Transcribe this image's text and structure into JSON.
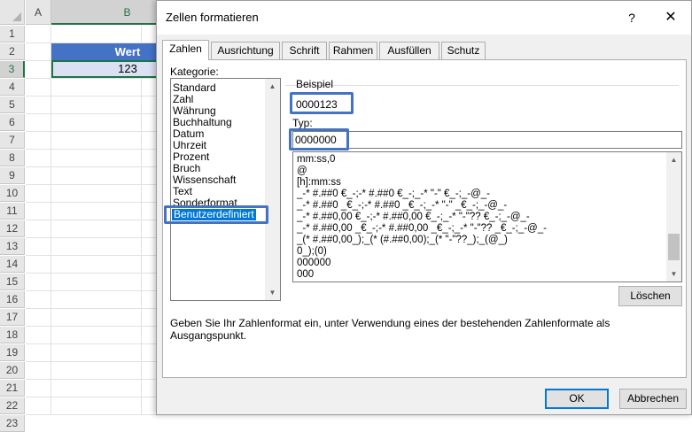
{
  "sheet": {
    "columns": [
      "A",
      "B"
    ],
    "rows": [
      "1",
      "2",
      "3",
      "4",
      "5",
      "6",
      "7",
      "8",
      "9",
      "10",
      "11",
      "12",
      "13",
      "14",
      "15",
      "16",
      "17",
      "18",
      "19",
      "20",
      "21",
      "22",
      "23"
    ],
    "header_cell": "Wert",
    "value_cell": "123"
  },
  "dialog": {
    "title": "Zellen formatieren",
    "help_glyph": "?",
    "close_glyph": "✕",
    "tabs": [
      "Zahlen",
      "Ausrichtung",
      "Schrift",
      "Rahmen",
      "Ausfüllen",
      "Schutz"
    ],
    "active_tab": "Zahlen",
    "kategorie_label": "Kategorie:",
    "categories": [
      "Standard",
      "Zahl",
      "Währung",
      "Buchhaltung",
      "Datum",
      "Uhrzeit",
      "Prozent",
      "Bruch",
      "Wissenschaft",
      "Text",
      "Sonderformat",
      "Benutzerdefiniert"
    ],
    "selected_category": "Benutzerdefiniert",
    "beispiel_label": "Beispiel",
    "beispiel_value": "0000123",
    "typ_label": "Typ:",
    "typ_value": "0000000",
    "formats": [
      "mm:ss,0",
      "@",
      "[h]:mm:ss",
      "_-* #.##0 €_-;-* #.##0 €_-;_-* \"-\" €_-;_-@_-",
      "_-* #.##0 _€_-;-* #.##0 _€_-;_-* \"-\" _€_-;_-@_-",
      "_-* #.##0,00 €_-;-* #.##0,00 €_-;_-* \"-\"?? €_-;_-@_-",
      "_-* #.##0,00 _€_-;-* #.##0,00 _€_-;_-* \"-\"?? _€_-;_-@_-",
      "_(* #.##0,00_);_(* (#.##0,00);_(* \"-\"??_);_(@_)",
      "0_);(0)",
      "000000",
      "000"
    ],
    "loeschen_label": "Löschen",
    "hint": "Geben Sie Ihr Zahlenformat ein, unter Verwendung eines der bestehenden Zahlenformate als Ausgangspunkt.",
    "ok_label": "OK",
    "cancel_label": "Abbrechen"
  },
  "colors": {
    "header_fill": "#4472c4",
    "value_fill": "#d9e1f2",
    "highlight": "#4472c4",
    "selection": "#0078d7"
  }
}
